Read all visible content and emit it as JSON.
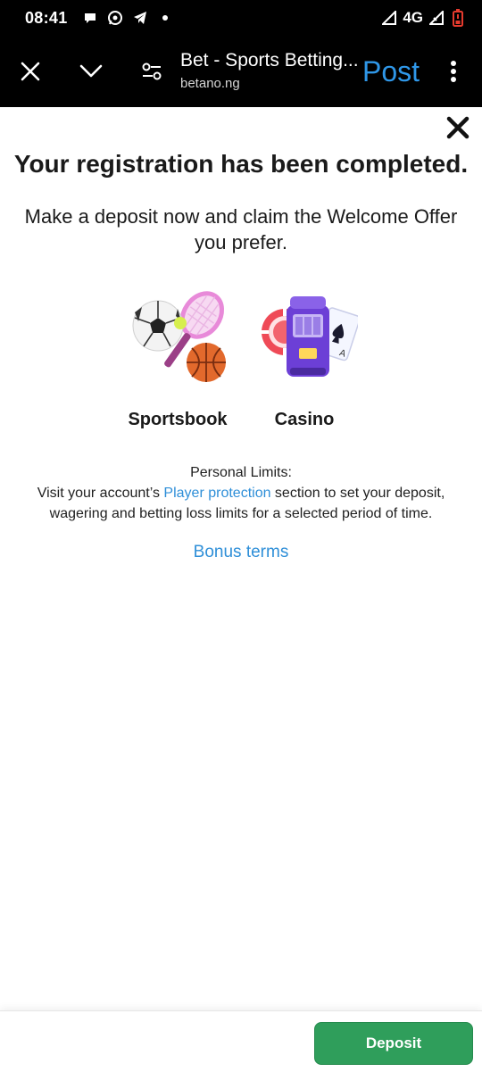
{
  "status_bar": {
    "time": "08:41",
    "network": "4G",
    "icons": [
      "chat-bubble-icon",
      "whatsapp-icon",
      "telegram-icon",
      "dot-icon",
      "signal-icon",
      "battery-icon"
    ]
  },
  "browser": {
    "page_title": "Bet - Sports Betting...",
    "url": "betano.ng",
    "post_label": "Post",
    "accent_color": "#2f97e8"
  },
  "dialog": {
    "headline": "Your registration has been completed.",
    "subline": "Make a deposit now and claim the Welcome Offer you prefer.",
    "offers": [
      {
        "label": "Sportsbook",
        "icon": "sports-balls-icon"
      },
      {
        "label": "Casino",
        "icon": "casino-slot-icon"
      }
    ],
    "limits": {
      "title": "Personal Limits:",
      "text_before": "Visit your account’s ",
      "link": "Player protection",
      "text_after": " section to set your deposit, wagering and betting loss limits for a selected period of time."
    },
    "bonus_terms": "Bonus terms",
    "link_color": "#2f8fd8"
  },
  "footer": {
    "deposit_label": "Deposit",
    "deposit_color": "#2f9e5b"
  }
}
